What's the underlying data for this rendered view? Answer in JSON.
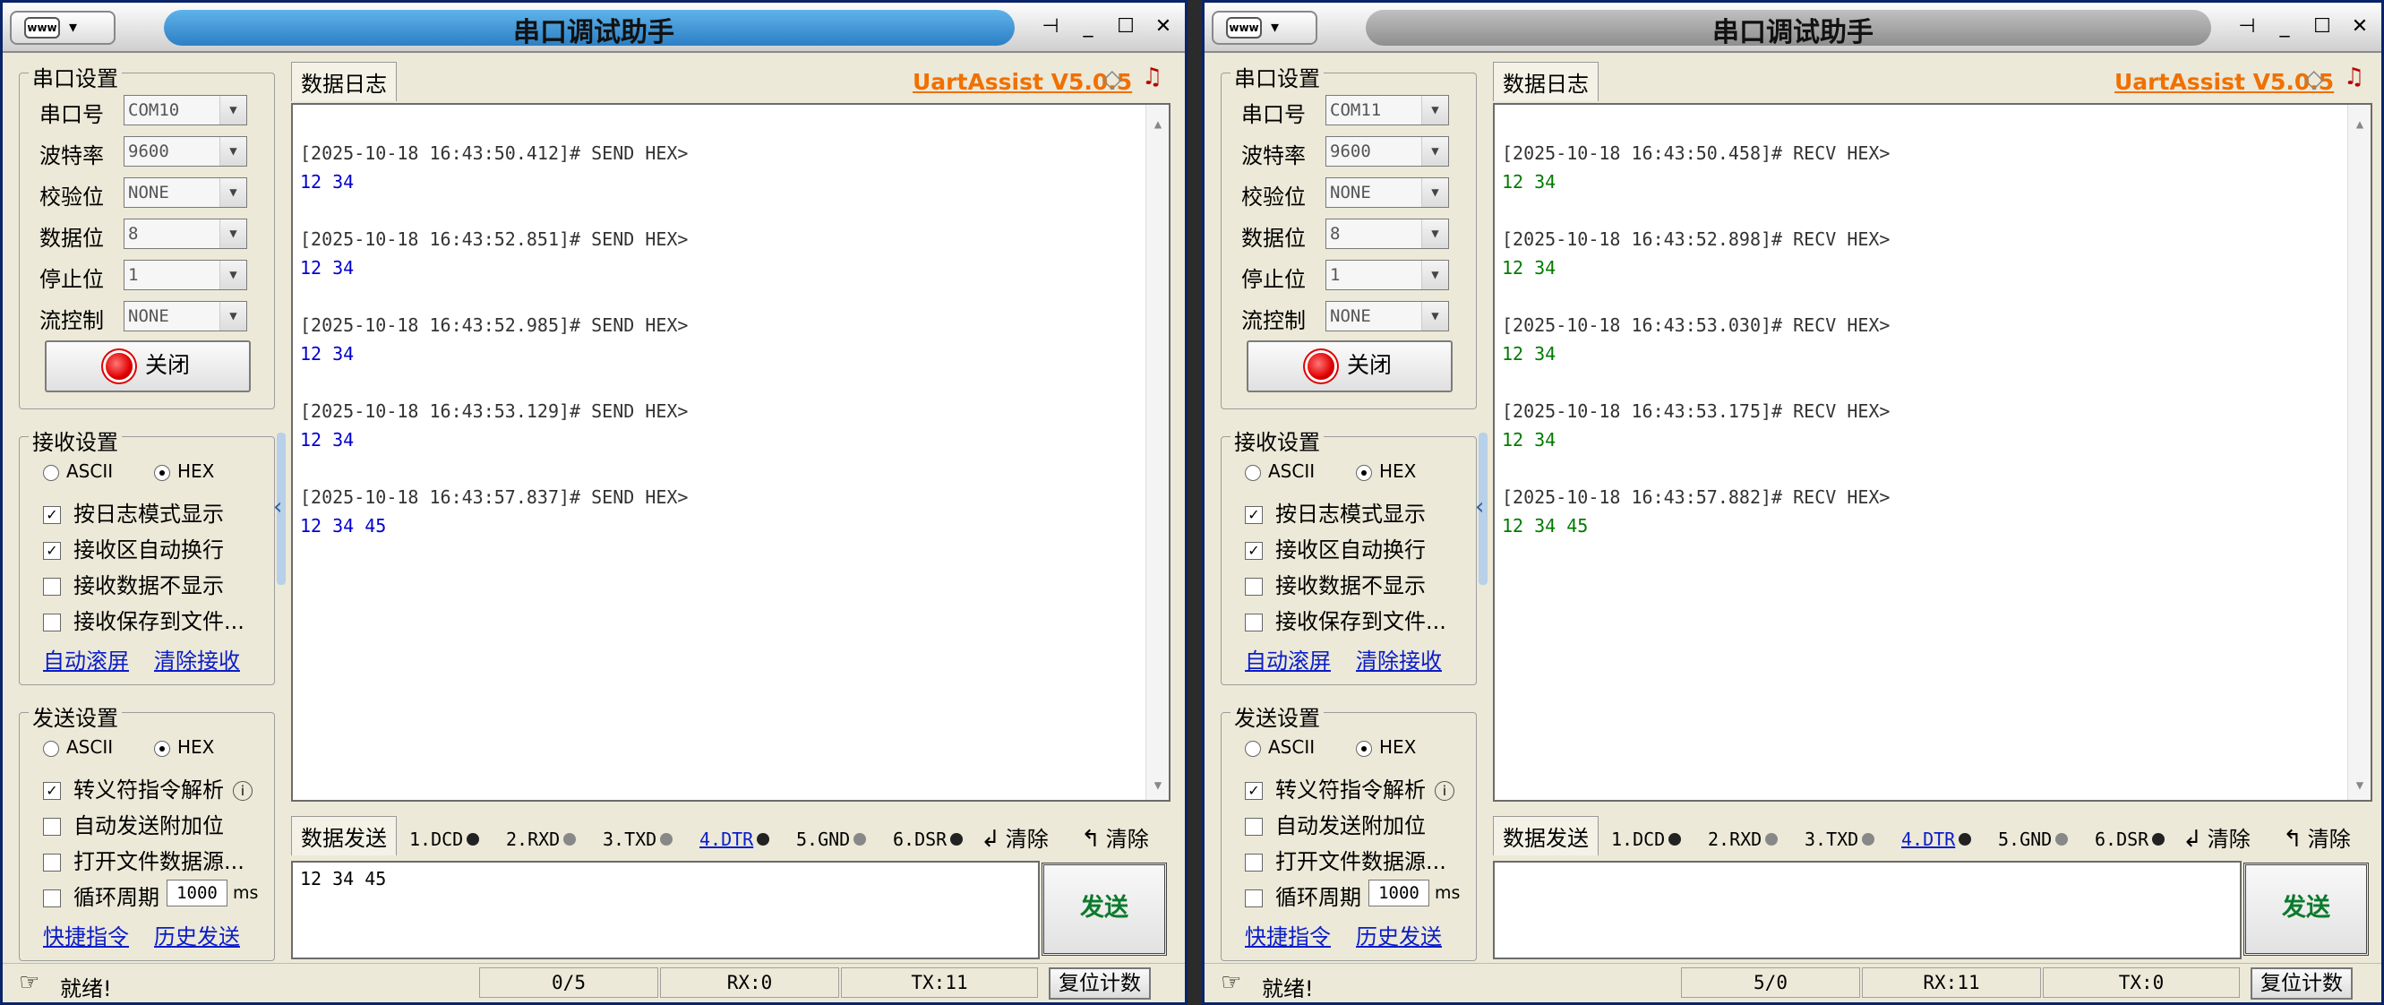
{
  "windows": [
    {
      "title": "串口调试助手",
      "brand": "UartAssist V5.0.5",
      "serial": {
        "group": "串口设置",
        "port_label": "串口号",
        "port": "COM10",
        "baud_label": "波特率",
        "baud": "9600",
        "parity_label": "校验位",
        "parity": "NONE",
        "data_label": "数据位",
        "data": "8",
        "stop_label": "停止位",
        "stop": "1",
        "flow_label": "流控制",
        "flow": "NONE",
        "close_btn": "关闭"
      },
      "recv": {
        "group": "接收设置",
        "ascii": "ASCII",
        "hex": "HEX",
        "opt1": "按日志模式显示",
        "opt2": "接收区自动换行",
        "opt3": "接收数据不显示",
        "opt4": "接收保存到文件...",
        "link1": "自动滚屏",
        "link2": "清除接收"
      },
      "send": {
        "group": "发送设置",
        "ascii": "ASCII",
        "hex": "HEX",
        "opt1": "转义符指令解析",
        "opt2": "自动发送附加位",
        "opt3": "打开文件数据源...",
        "opt4": "循环周期",
        "period": "1000",
        "unit": "ms",
        "link1": "快捷指令",
        "link2": "历史发送"
      },
      "log_tab": "数据日志",
      "log": [
        {
          "hdr": "[2025-10-18 16:43:50.412]# SEND HEX>",
          "data": "12 34"
        },
        {
          "hdr": "[2025-10-18 16:43:52.851]# SEND HEX>",
          "data": "12 34"
        },
        {
          "hdr": "[2025-10-18 16:43:52.985]# SEND HEX>",
          "data": "12 34"
        },
        {
          "hdr": "[2025-10-18 16:43:53.129]# SEND HEX>",
          "data": "12 34"
        },
        {
          "hdr": "[2025-10-18 16:43:57.837]# SEND HEX>",
          "data": "12 34 45"
        }
      ],
      "log_color": "#0000d0",
      "send_tab": "数据发送",
      "signals": [
        "1.DCD",
        "2.RXD",
        "3.TXD",
        "4.DTR",
        "5.GND",
        "6.DSR"
      ],
      "clear1": "清除",
      "clear2": "清除",
      "send_text": "12 34 45",
      "send_btn": "发送",
      "status": {
        "ready": "就绪!",
        "count": "0/5",
        "rx": "RX:0",
        "tx": "TX:11",
        "reset": "复位计数"
      }
    },
    {
      "title": "串口调试助手",
      "brand": "UartAssist V5.0.5",
      "serial": {
        "group": "串口设置",
        "port_label": "串口号",
        "port": "COM11",
        "baud_label": "波特率",
        "baud": "9600",
        "parity_label": "校验位",
        "parity": "NONE",
        "data_label": "数据位",
        "data": "8",
        "stop_label": "停止位",
        "stop": "1",
        "flow_label": "流控制",
        "flow": "NONE",
        "close_btn": "关闭"
      },
      "recv": {
        "group": "接收设置",
        "ascii": "ASCII",
        "hex": "HEX",
        "opt1": "按日志模式显示",
        "opt2": "接收区自动换行",
        "opt3": "接收数据不显示",
        "opt4": "接收保存到文件...",
        "link1": "自动滚屏",
        "link2": "清除接收"
      },
      "send": {
        "group": "发送设置",
        "ascii": "ASCII",
        "hex": "HEX",
        "opt1": "转义符指令解析",
        "opt2": "自动发送附加位",
        "opt3": "打开文件数据源...",
        "opt4": "循环周期",
        "period": "1000",
        "unit": "ms",
        "link1": "快捷指令",
        "link2": "历史发送"
      },
      "log_tab": "数据日志",
      "log": [
        {
          "hdr": "[2025-10-18 16:43:50.458]# RECV HEX>",
          "data": "12 34"
        },
        {
          "hdr": "[2025-10-18 16:43:52.898]# RECV HEX>",
          "data": "12 34"
        },
        {
          "hdr": "[2025-10-18 16:43:53.030]# RECV HEX>",
          "data": "12 34"
        },
        {
          "hdr": "[2025-10-18 16:43:53.175]# RECV HEX>",
          "data": "12 34"
        },
        {
          "hdr": "[2025-10-18 16:43:57.882]# RECV HEX>",
          "data": "12 34 45"
        }
      ],
      "log_color": "#007a00",
      "send_tab": "数据发送",
      "signals": [
        "1.DCD",
        "2.RXD",
        "3.TXD",
        "4.DTR",
        "5.GND",
        "6.DSR"
      ],
      "clear1": "清除",
      "clear2": "清除",
      "send_text": "",
      "send_btn": "发送",
      "status": {
        "ready": "就绪!",
        "count": "5/0",
        "rx": "RX:11",
        "tx": "TX:0",
        "reset": "复位计数"
      }
    }
  ]
}
